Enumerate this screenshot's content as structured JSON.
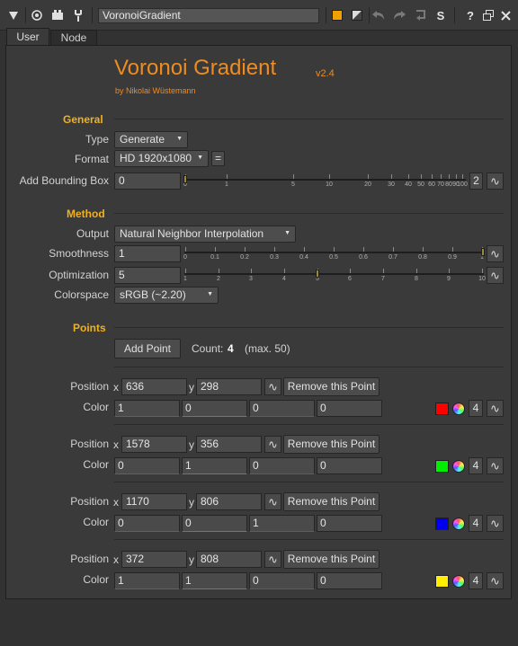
{
  "toolbar": {
    "node_name": "VoronoiGradient",
    "icons": [
      "collapse-triangle-icon",
      "center-node-icon",
      "node-settings-icon",
      "customize-icon",
      "color-swatch-icon",
      "reset-icon",
      "undo-icon",
      "redo-icon",
      "revert-icon",
      "lock-icon",
      "help-icon",
      "float-panel-icon",
      "close-icon"
    ],
    "help_label": "?",
    "s_label": "S"
  },
  "tabs": [
    "User",
    "Node"
  ],
  "header": {
    "title": "Voronoi Gradient",
    "version": "v2.4",
    "author": "by Nikolai Wüstemann"
  },
  "general": {
    "section_label": "General",
    "type_label": "Type",
    "type_value": "Generate",
    "format_label": "Format",
    "format_value": "HD 1920x1080",
    "format_eq": "=",
    "bbox_label": "Add Bounding Box",
    "bbox_value": "0",
    "bbox_ticks": [
      "0",
      "1",
      "5",
      "10",
      "20",
      "30",
      "40",
      "50",
      "60",
      "70",
      "80",
      "90",
      "100"
    ],
    "bbox_extra": "2"
  },
  "method": {
    "section_label": "Method",
    "output_label": "Output",
    "output_value": "Natural Neighbor Interpolation",
    "smooth_label": "Smoothness",
    "smooth_value": "1",
    "smooth_ticks": [
      "0",
      "0.1",
      "0.2",
      "0.3",
      "0.4",
      "0.5",
      "0.6",
      "0.7",
      "0.8",
      "0.9",
      "1"
    ],
    "optim_label": "Optimization",
    "optim_value": "5",
    "optim_ticks": [
      "1",
      "2",
      "3",
      "4",
      "5",
      "6",
      "7",
      "8",
      "9",
      "10"
    ],
    "colorspace_label": "Colorspace",
    "colorspace_value": "sRGB (~2.20)"
  },
  "points": {
    "section_label": "Points",
    "add_label": "Add Point",
    "count_label": "Count:",
    "count_value": "4",
    "count_max": "(max. 50)",
    "position_label": "Position",
    "x_label": "x",
    "y_label": "y",
    "color_label": "Color",
    "remove_label": "Remove this Point",
    "list": [
      {
        "x": "636",
        "y": "298",
        "r": "1",
        "g": "0",
        "b": "0",
        "a": "0",
        "swatch": "#ff0000",
        "channels": "4"
      },
      {
        "x": "1578",
        "y": "356",
        "r": "0",
        "g": "1",
        "b": "0",
        "a": "0",
        "swatch": "#00ee00",
        "channels": "4"
      },
      {
        "x": "1170",
        "y": "806",
        "r": "0",
        "g": "0",
        "b": "1",
        "a": "0",
        "swatch": "#0000ee",
        "channels": "4"
      },
      {
        "x": "372",
        "y": "808",
        "r": "1",
        "g": "1",
        "b": "0",
        "a": "0",
        "swatch": "#ffee00",
        "channels": "4"
      }
    ]
  }
}
